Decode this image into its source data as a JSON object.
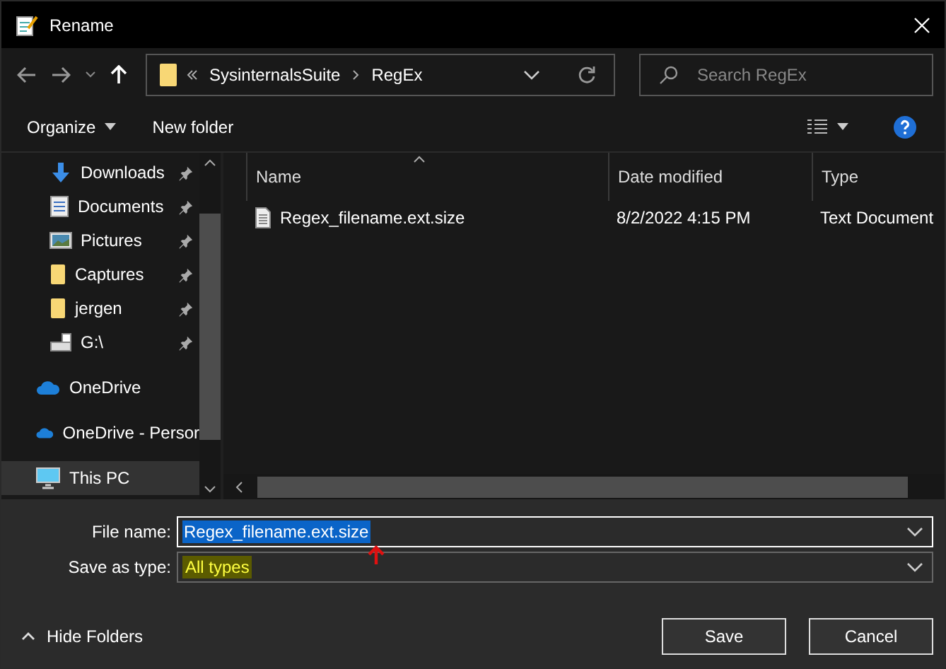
{
  "window": {
    "title": "Rename"
  },
  "address_bar": {
    "breadcrumbs": [
      "SysinternalsSuite",
      "RegEx"
    ]
  },
  "search": {
    "placeholder": "Search RegEx"
  },
  "toolbar": {
    "buttons": [
      "Organize",
      "New folder"
    ]
  },
  "sidebar": {
    "items": [
      {
        "label": "Downloads",
        "kind": "downloads",
        "pinned": true,
        "selected": false
      },
      {
        "label": "Documents",
        "kind": "documents",
        "pinned": true,
        "selected": false
      },
      {
        "label": "Pictures",
        "kind": "pictures",
        "pinned": true,
        "selected": false
      },
      {
        "label": "Captures",
        "kind": "folder",
        "pinned": true,
        "selected": false
      },
      {
        "label": "jergen",
        "kind": "folder",
        "pinned": true,
        "selected": false
      },
      {
        "label": "G:\\",
        "kind": "drive",
        "pinned": true,
        "selected": false
      },
      {
        "label": "OneDrive",
        "kind": "cloud",
        "pinned": false,
        "selected": false
      },
      {
        "label": "OneDrive - Persor",
        "kind": "cloud",
        "pinned": false,
        "selected": false
      },
      {
        "label": "This PC",
        "kind": "pc",
        "pinned": false,
        "selected": true
      }
    ]
  },
  "table": {
    "columns": [
      "Name",
      "Date modified",
      "Type"
    ],
    "rows": [
      {
        "name": "Regex_filename.ext.size",
        "date_modified": "8/2/2022 4:15 PM",
        "type": "Text Document"
      }
    ]
  },
  "form": {
    "file_name": {
      "label": "File name:",
      "value": "Regex_filename.ext.size"
    },
    "save_as_type": {
      "label": "Save as type:",
      "value": "All types"
    }
  },
  "hide_folders": "Hide Folders",
  "buttons": [
    "Save",
    "Cancel"
  ]
}
